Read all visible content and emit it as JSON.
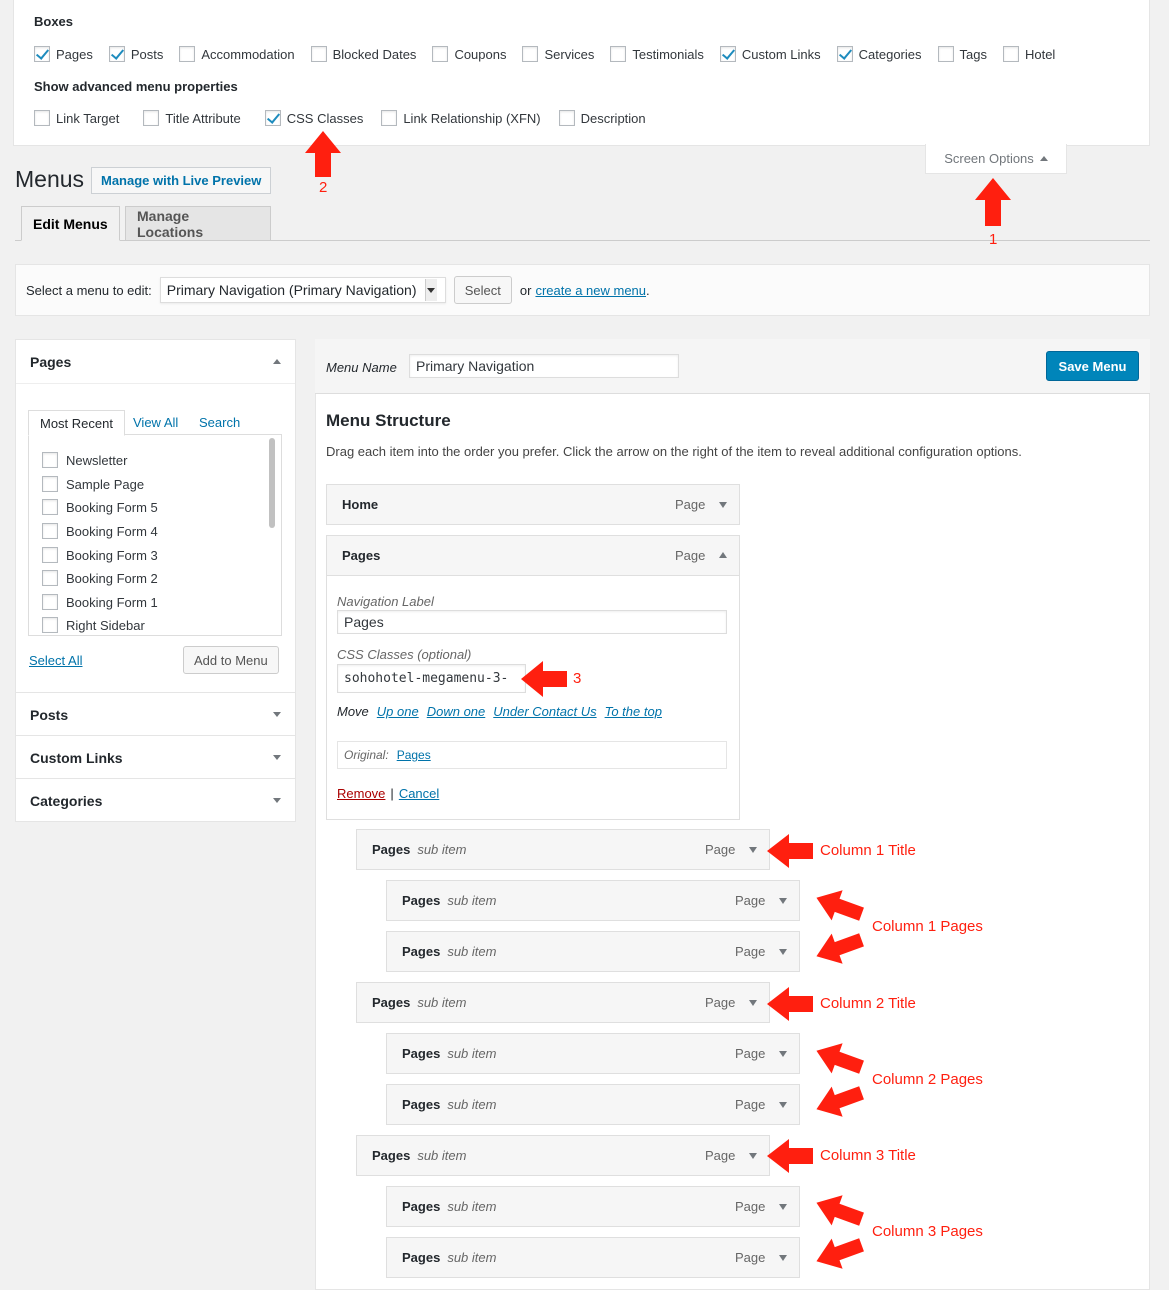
{
  "screen_options": {
    "boxes_heading": "Boxes",
    "boxes": [
      {
        "label": "Pages",
        "checked": true
      },
      {
        "label": "Posts",
        "checked": true
      },
      {
        "label": "Accommodation",
        "checked": false
      },
      {
        "label": "Blocked Dates",
        "checked": false
      },
      {
        "label": "Coupons",
        "checked": false
      },
      {
        "label": "Services",
        "checked": false
      },
      {
        "label": "Testimonials",
        "checked": false
      },
      {
        "label": "Custom Links",
        "checked": true
      },
      {
        "label": "Categories",
        "checked": true
      },
      {
        "label": "Tags",
        "checked": false
      },
      {
        "label": "Hotel",
        "checked": false
      }
    ],
    "advanced_heading": "Show advanced menu properties",
    "advanced": [
      {
        "label": "Link Target",
        "checked": false
      },
      {
        "label": "Title Attribute",
        "checked": false
      },
      {
        "label": "CSS Classes",
        "checked": true
      },
      {
        "label": "Link Relationship (XFN)",
        "checked": false
      },
      {
        "label": "Description",
        "checked": false
      }
    ],
    "tab_label": "Screen Options"
  },
  "page": {
    "title": "Menus",
    "live_preview_button": "Manage with Live Preview",
    "tabs": [
      "Edit Menus",
      "Manage Locations"
    ]
  },
  "manage_menus": {
    "label": "Select a menu to edit:",
    "selected": "Primary Navigation (Primary Navigation)",
    "select_button": "Select",
    "or_text": "or",
    "create_link": "create a new menu",
    "period": "."
  },
  "sidebar": {
    "pages_title": "Pages",
    "tabs": [
      "Most Recent",
      "View All",
      "Search"
    ],
    "pages": [
      "Newsletter",
      "Sample Page",
      "Booking Form 5",
      "Booking Form 4",
      "Booking Form 3",
      "Booking Form 2",
      "Booking Form 1",
      "Right Sidebar"
    ],
    "select_all": "Select All",
    "add_to_menu": "Add to Menu",
    "other_sections": [
      "Posts",
      "Custom Links",
      "Categories"
    ]
  },
  "menu": {
    "name_label": "Menu Name",
    "name_value": "Primary Navigation",
    "save_button": "Save Menu",
    "structure_title": "Menu Structure",
    "structure_help": "Drag each item into the order you prefer. Click the arrow on the right of the item to reveal additional configuration options.",
    "items": [
      {
        "title": "Home",
        "sub": "",
        "type": "Page"
      },
      {
        "title": "Pages",
        "sub": "",
        "type": "Page"
      }
    ],
    "settings": {
      "nav_label": "Navigation Label",
      "nav_value": "Pages",
      "css_label": "CSS Classes (optional)",
      "css_value": "sohohotel-megamenu-3-",
      "move_label": "Move",
      "move_links": [
        "Up one",
        "Down one",
        "Under Contact Us",
        "To the top"
      ],
      "original_label": "Original:",
      "original_link": "Pages",
      "remove": "Remove",
      "separator": "|",
      "cancel": "Cancel"
    },
    "sub_items": [
      {
        "title": "Pages",
        "sub": "sub item",
        "type": "Page",
        "depth": 1
      },
      {
        "title": "Pages",
        "sub": "sub item",
        "type": "Page",
        "depth": 2
      },
      {
        "title": "Pages",
        "sub": "sub item",
        "type": "Page",
        "depth": 2
      },
      {
        "title": "Pages",
        "sub": "sub item",
        "type": "Page",
        "depth": 1
      },
      {
        "title": "Pages",
        "sub": "sub item",
        "type": "Page",
        "depth": 2
      },
      {
        "title": "Pages",
        "sub": "sub item",
        "type": "Page",
        "depth": 2
      },
      {
        "title": "Pages",
        "sub": "sub item",
        "type": "Page",
        "depth": 1
      },
      {
        "title": "Pages",
        "sub": "sub item",
        "type": "Page",
        "depth": 2
      },
      {
        "title": "Pages",
        "sub": "sub item",
        "type": "Page",
        "depth": 2
      }
    ]
  },
  "annotations": {
    "n1": "1",
    "n2": "2",
    "n3": "3",
    "col1_title": "Column 1 Title",
    "col1_pages": "Column 1 Pages",
    "col2_title": "Column 2 Title",
    "col2_pages": "Column 2 Pages",
    "col3_title": "Column 3 Title",
    "col3_pages": "Column 3 Pages",
    "color": "#ff1f0f"
  }
}
